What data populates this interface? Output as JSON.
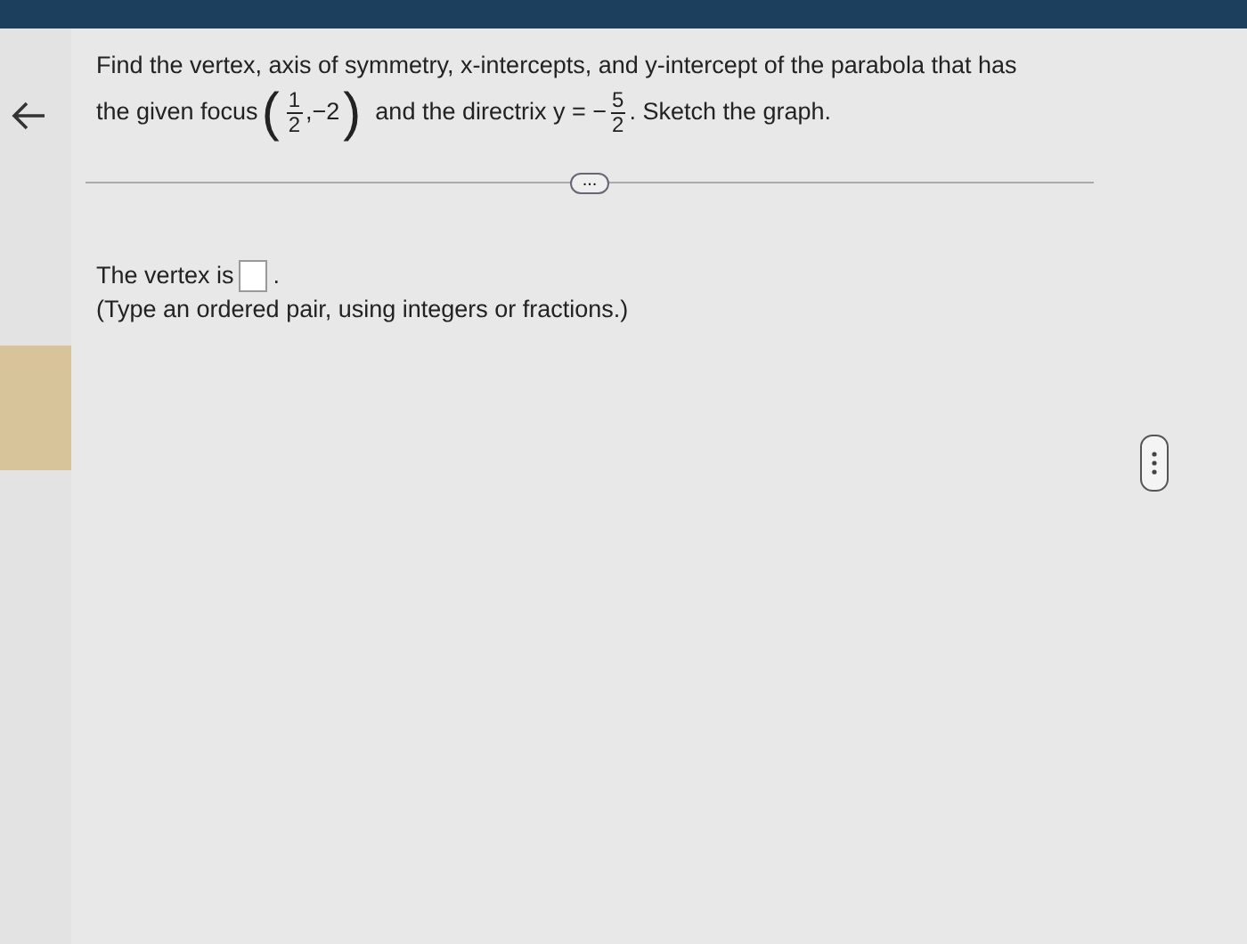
{
  "question": {
    "line1": "Find the vertex, axis of symmetry, x-intercepts, and y-intercept of the parabola that has",
    "before": "the given focus",
    "focus": {
      "open": "(",
      "num": "1",
      "den": "2",
      "sep": ",",
      "value": "−2",
      "close": ")"
    },
    "middle": "and the directrix y = −",
    "directrix": {
      "num": "5",
      "den": "2"
    },
    "after": ". Sketch the graph."
  },
  "more_button": "...",
  "answer": {
    "before": "The vertex is",
    "after": ".",
    "hint": "(Type an ordered pair, using integers or fractions.)"
  }
}
